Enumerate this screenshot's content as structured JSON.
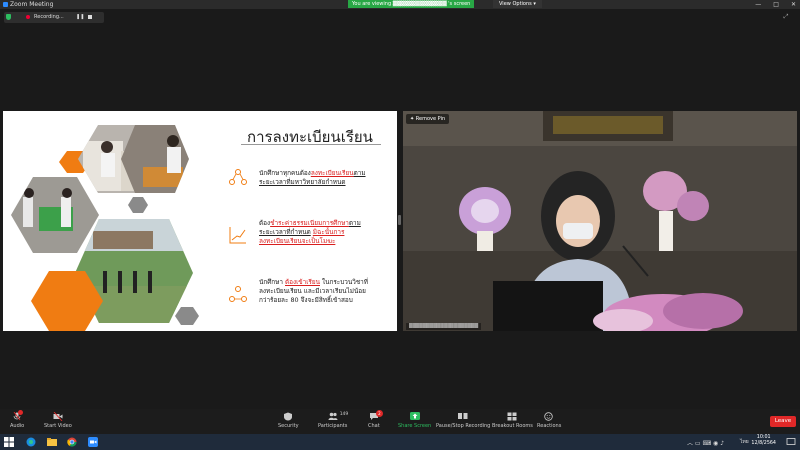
{
  "window": {
    "title": "Zoom Meeting",
    "controls": [
      "—",
      "□",
      "✕"
    ]
  },
  "viewing_banner": {
    "prefix": "You are viewing",
    "suffix": "'s screen"
  },
  "view_options": "View Options ▾",
  "recording": {
    "label": "Recording...",
    "pause": "❚❚"
  },
  "slide": {
    "title": "การลงทะเบียนเรียน",
    "points": [
      [
        {
          "t": "นักศึกษาทุกคนต้อง"
        },
        {
          "t": "ลงทะเบียนเรียน",
          "c": "hl ul"
        },
        {
          "t": "ตาม",
          "c": "ul"
        },
        {
          "t": "ระยะเวลาที่มหาวิทยาลัยกำหนด",
          "c": "ul",
          "br": true
        }
      ],
      [
        {
          "t": "ต้อง"
        },
        {
          "t": "ชำระค่าธรรมเนียมการศึกษา",
          "c": "hl ul"
        },
        {
          "t": "ตาม",
          "c": "ul"
        },
        {
          "t": "ระยะเวลาที่กำหนด",
          "c": "ul",
          "br": true
        },
        {
          "t": " "
        },
        {
          "t": "มิฉะนั้นการ",
          "c": "hl ul"
        },
        {
          "t": "ลงทะเบียนเรียนจะเป็นโมฆะ",
          "c": "hl ul",
          "br": true
        }
      ],
      [
        {
          "t": "นักศึกษา "
        },
        {
          "t": "ต้องเข้าเรียน",
          "c": "hl ul"
        },
        {
          "t": " ในกระบวนวิชาที่"
        },
        {
          "t": "ลงทะเบียนเรียน และมีเวลาเรียนไม่น้อย",
          "br": true
        },
        {
          "t": "กว่าร้อยละ 80 จึงจะมีสิทธิ์เข้าสอบ",
          "br": true
        }
      ]
    ]
  },
  "video": {
    "remove_pin": "Remove Pin"
  },
  "toolbar": {
    "audio": "Audio",
    "video": "Start Video",
    "security": "Security",
    "participants": "Participants",
    "participants_count": "149",
    "chat": "Chat",
    "chat_badge": "2",
    "share": "Share Screen",
    "recording": "Pause/Stop Recording",
    "breakout": "Breakout Rooms",
    "reactions": "Reactions",
    "leave": "Leave"
  },
  "taskbar": {
    "time": "10:01",
    "date": "12/8/2564",
    "lang": "ไทย"
  },
  "colors": {
    "accent_orange": "#f07c12",
    "leave_red": "#e02828",
    "share_green": "#2dbe60",
    "zoom_blue": "#2d8cff"
  }
}
